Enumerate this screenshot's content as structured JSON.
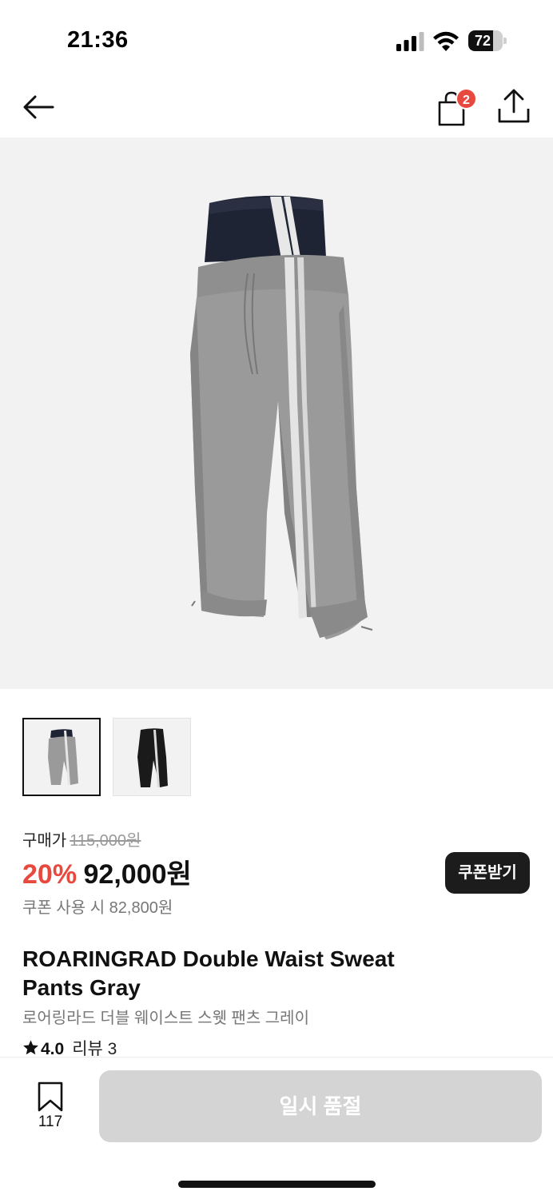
{
  "status_bar": {
    "time": "21:36",
    "battery": "72",
    "battery_level": 0.72
  },
  "nav": {
    "cart_count": "2"
  },
  "thumbnails": [
    {
      "color": "gray",
      "selected": true
    },
    {
      "color": "black",
      "selected": false
    }
  ],
  "price": {
    "label": "구매가",
    "original": "115,000원",
    "discount": "20%",
    "final": "92,000원",
    "coupon_price": "쿠폰 사용 시 82,800원",
    "coupon_button": "쿠폰받기"
  },
  "product": {
    "title": "ROARINGRAD Double Waist Sweat Pants Gray",
    "subtitle": "로어링라드 더블 웨이스트 스웻 팬츠 그레이",
    "rating": "4.0",
    "reviews": "리뷰 3"
  },
  "bottom": {
    "bookmark_count": "117",
    "soldout_label": "일시 품절"
  },
  "colors": {
    "accent": "#e8493f",
    "dark": "#1c1c1c",
    "disabled": "#d4d4d4",
    "image_bg": "#f2f2f2"
  }
}
